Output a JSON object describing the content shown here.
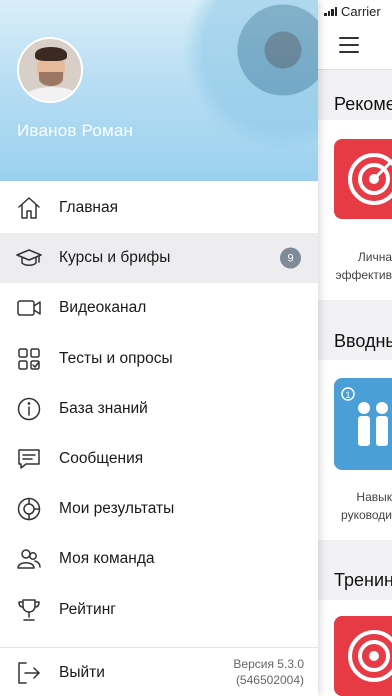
{
  "status_bar": {
    "carrier": "Carrier"
  },
  "background_screen": {
    "sections": [
      {
        "title": "Рекоме",
        "caption_line1": "Лична",
        "caption_line2": "эффектив"
      },
      {
        "title": "Вводны",
        "caption_line1": "Навык",
        "caption_line2": "руководи"
      },
      {
        "title": "Тренин"
      }
    ],
    "tile_badge": "1"
  },
  "drawer": {
    "user_name": "Иванов Роман",
    "menu_items": [
      {
        "label": "Главная",
        "icon": "home-icon"
      },
      {
        "label": "Курсы и брифы",
        "icon": "graduation-cap-icon",
        "badge": "9",
        "active": true
      },
      {
        "label": "Видеоканал",
        "icon": "video-camera-icon"
      },
      {
        "label": "Тесты и опросы",
        "icon": "tests-grid-icon"
      },
      {
        "label": "База знаний",
        "icon": "info-icon"
      },
      {
        "label": "Сообщения",
        "icon": "message-icon"
      },
      {
        "label": "Мои результаты",
        "icon": "results-chart-icon"
      },
      {
        "label": "Моя команда",
        "icon": "team-icon"
      },
      {
        "label": "Рейтинг",
        "icon": "trophy-icon"
      }
    ],
    "logout_label": "Выйти",
    "version_line1": "Версия 5.3.0",
    "version_line2": "(546502004)"
  },
  "colors": {
    "accent_red": "#e63a44",
    "accent_blue": "#4a9fd6",
    "badge_gray": "#7f8b96",
    "active_row": "#ededf0"
  }
}
